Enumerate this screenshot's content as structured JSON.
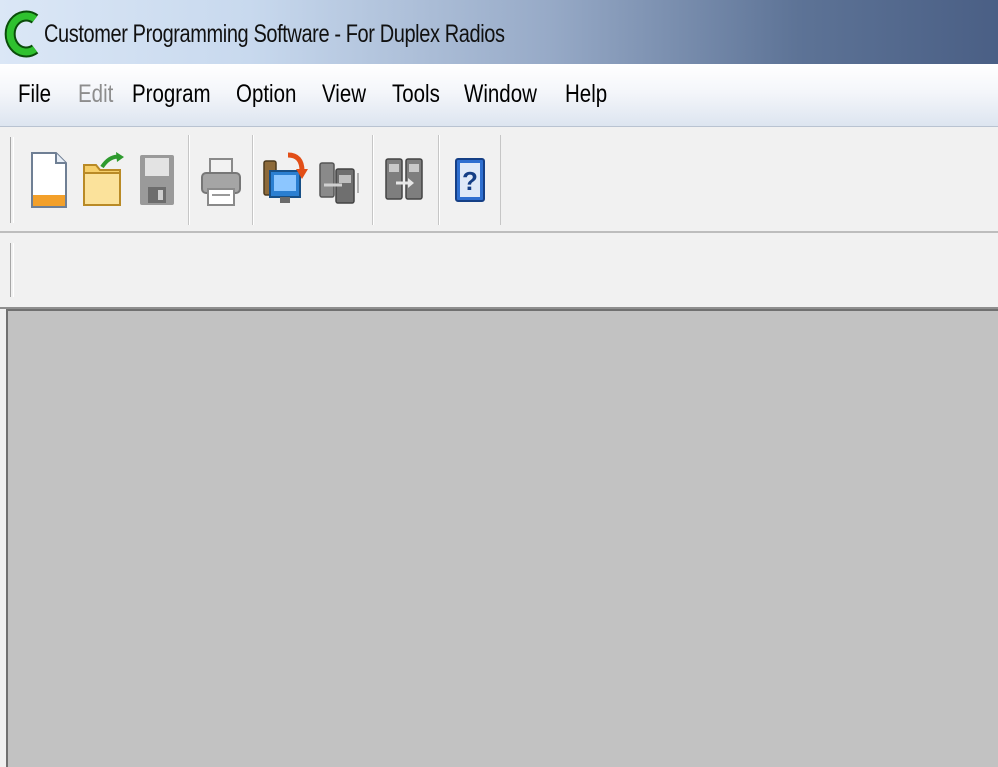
{
  "window": {
    "title": "Customer Programming Software - For Duplex Radios",
    "icon": "app-c-logo-icon"
  },
  "menu": [
    {
      "label": "File",
      "enabled": true
    },
    {
      "label": "Edit",
      "enabled": false
    },
    {
      "label": "Program",
      "enabled": true
    },
    {
      "label": "Option",
      "enabled": true
    },
    {
      "label": "View",
      "enabled": true
    },
    {
      "label": "Tools",
      "enabled": true
    },
    {
      "label": "Window",
      "enabled": true
    },
    {
      "label": "Help",
      "enabled": true
    }
  ],
  "toolbar": {
    "buttons": [
      {
        "icon": "new-file-icon",
        "enabled": true
      },
      {
        "icon": "open-folder-icon",
        "enabled": true
      },
      {
        "icon": "save-disk-icon",
        "enabled": false
      },
      {
        "icon": "print-icon",
        "enabled": false
      },
      {
        "icon": "read-from-radio-icon",
        "enabled": true
      },
      {
        "icon": "write-to-radio-icon",
        "enabled": false
      },
      {
        "icon": "clone-radio-icon",
        "enabled": false
      },
      {
        "icon": "help-icon",
        "enabled": true
      }
    ]
  },
  "colors": {
    "titlebar_start": "#dbe7f6",
    "titlebar_end": "#4a5f85",
    "workspace": "#c2c2c2",
    "logo_green": "#2fc12f"
  }
}
